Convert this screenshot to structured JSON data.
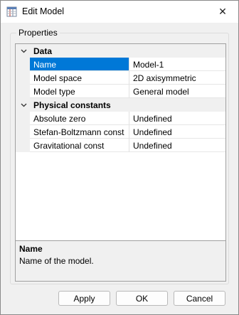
{
  "window": {
    "title": "Edit Model",
    "icon": "table-app-icon"
  },
  "properties": {
    "group_label": "Properties",
    "categories": [
      {
        "label": "Data",
        "expanded": true,
        "rows": [
          {
            "name": "Name",
            "value": "Model-1",
            "selected": true
          },
          {
            "name": "Model space",
            "value": "2D axisymmetric"
          },
          {
            "name": "Model type",
            "value": "General model"
          }
        ]
      },
      {
        "label": "Physical constants",
        "expanded": true,
        "rows": [
          {
            "name": "Absolute zero",
            "value": "Undefined"
          },
          {
            "name": "Stefan-Boltzmann const",
            "value": "Undefined"
          },
          {
            "name": "Gravitational const",
            "value": "Undefined"
          }
        ]
      }
    ]
  },
  "help": {
    "title": "Name",
    "description": "Name of the model."
  },
  "buttons": {
    "apply": "Apply",
    "ok": "OK",
    "cancel": "Cancel"
  },
  "colors": {
    "selection": "#0078d7",
    "dialog_bg": "#f0f0f0"
  }
}
